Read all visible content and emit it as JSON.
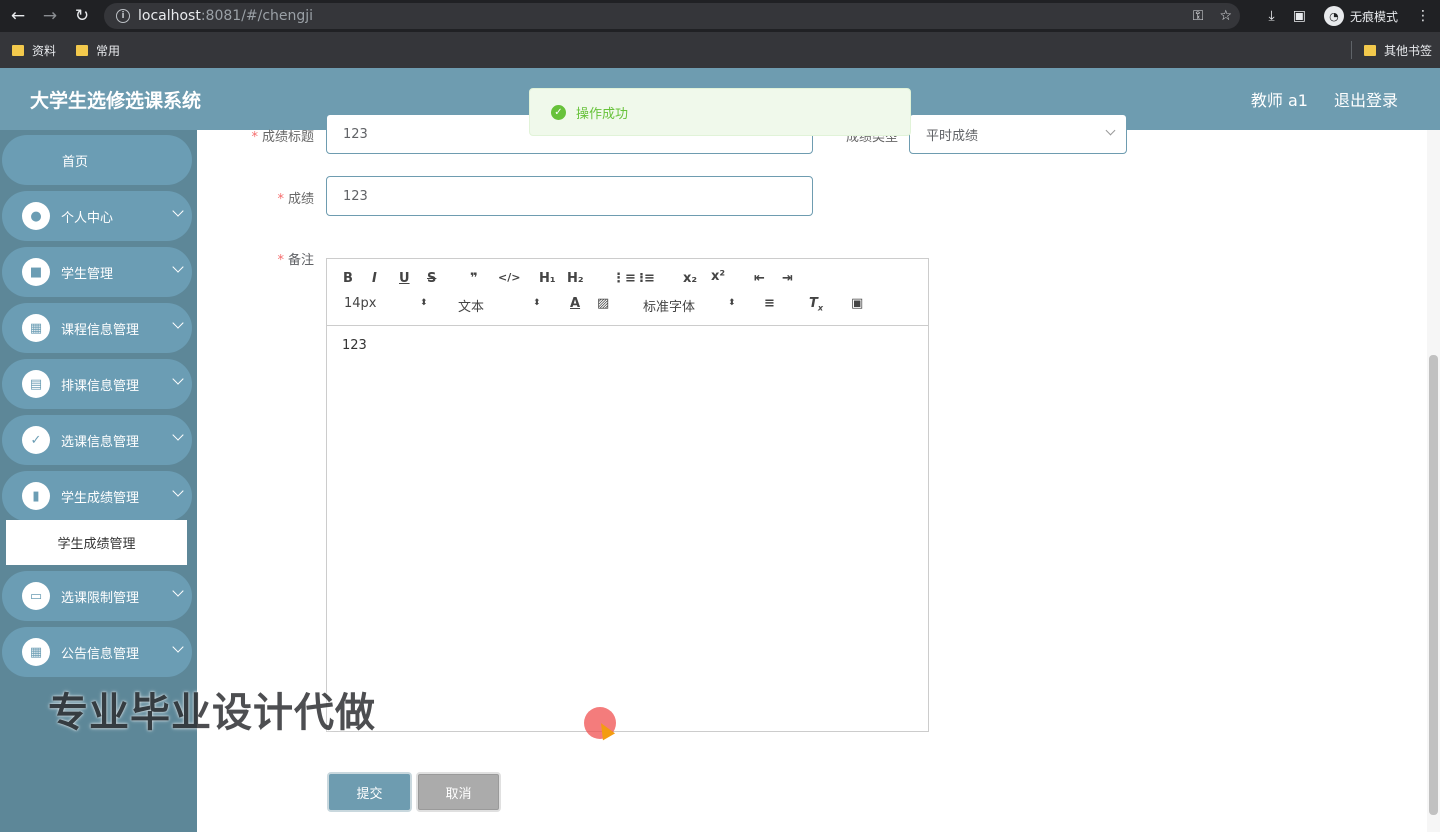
{
  "browser": {
    "url_host": "localhost",
    "url_rest": ":8081/#/chengji",
    "incognito_label": "无痕模式",
    "bookmarks": [
      {
        "label": "资料"
      },
      {
        "label": "常用"
      }
    ],
    "other_bookmarks": "其他书签"
  },
  "header": {
    "title": "大学生选修选课系统",
    "user": "教师 a1",
    "logout": "退出登录"
  },
  "sidebar": {
    "home": "首页",
    "items": [
      {
        "label": "个人中心",
        "icon": "user-icon"
      },
      {
        "label": "学生管理",
        "icon": "briefcase-icon"
      },
      {
        "label": "课程信息管理",
        "icon": "grid-icon"
      },
      {
        "label": "排课信息管理",
        "icon": "clipboard-icon"
      },
      {
        "label": "选课信息管理",
        "icon": "clipboard-check-icon"
      },
      {
        "label": "学生成绩管理",
        "icon": "bar-chart-icon"
      },
      {
        "label": "选课限制管理",
        "icon": "monitor-icon"
      },
      {
        "label": "公告信息管理",
        "icon": "grid-icon"
      }
    ],
    "submenu_active": "学生成绩管理"
  },
  "form": {
    "title_label": "成绩标题",
    "title_value": "123",
    "type_label": "成绩类型",
    "type_value": "平时成绩",
    "score_label": "成绩",
    "score_value": "123",
    "remark_label": "备注",
    "remark_value": "123",
    "font_size": "14px",
    "block_type": "文本",
    "font_family": "标准字体",
    "submit": "提交",
    "cancel": "取消"
  },
  "toast": {
    "message": "操作成功"
  },
  "watermark": "专业毕业设计代做",
  "colors": {
    "header": "#6e9cb0",
    "sidebar": "#5d8798",
    "success": "#67c23a"
  }
}
